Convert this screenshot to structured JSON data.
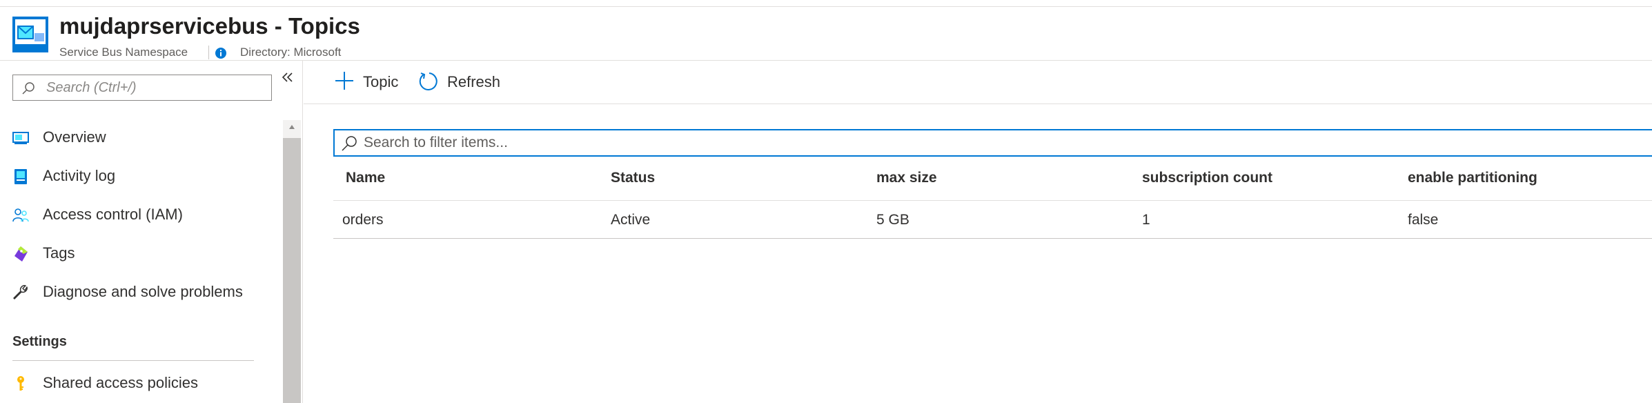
{
  "header": {
    "title": "mujdaprservicebus - Topics",
    "subtitle": "Service Bus Namespace",
    "directory": "Directory: Microsoft",
    "logo_icon": "service-bus-icon",
    "info_icon": "info-icon"
  },
  "sidebar": {
    "search_placeholder": "Search (Ctrl+/)",
    "items": [
      {
        "label": "Overview",
        "icon": "overview-icon"
      },
      {
        "label": "Activity log",
        "icon": "activity-log-icon"
      },
      {
        "label": "Access control (IAM)",
        "icon": "access-control-icon"
      },
      {
        "label": "Tags",
        "icon": "tag-icon"
      },
      {
        "label": "Diagnose and solve problems",
        "icon": "wrench-icon"
      }
    ],
    "section_settings": "Settings",
    "settings_items": [
      {
        "label": "Shared access policies",
        "icon": "key-icon"
      }
    ]
  },
  "toolbar": {
    "add_topic_label": "Topic",
    "refresh_label": "Refresh"
  },
  "filter": {
    "placeholder": "Search to filter items..."
  },
  "table": {
    "columns": [
      "Name",
      "Status",
      "max size",
      "subscription count",
      "enable partitioning"
    ],
    "rows": [
      [
        "orders",
        "Active",
        "5 GB",
        "1",
        "false"
      ]
    ]
  },
  "colors": {
    "accent": "#0078d4",
    "text": "#323130",
    "secondary_text": "#605e5c",
    "border": "#e1dfdd"
  }
}
